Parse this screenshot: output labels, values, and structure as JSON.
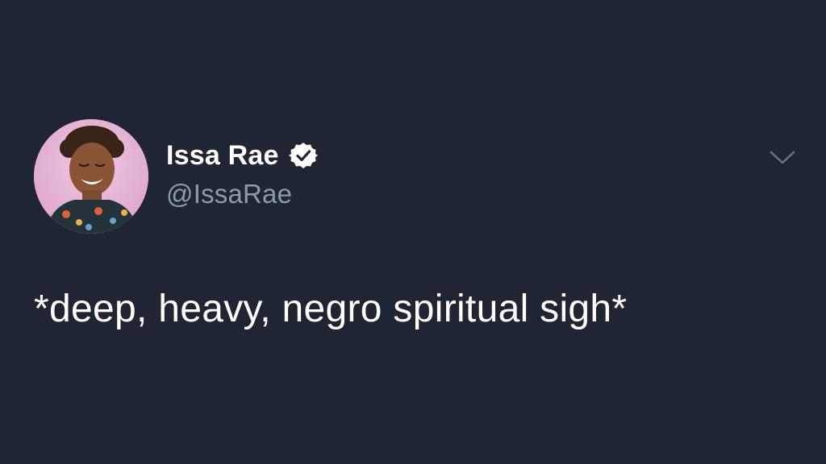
{
  "tweet": {
    "author": {
      "display_name": "Issa Rae",
      "handle": "@IssaRae",
      "verified": true,
      "avatar_icon": "profile-photo"
    },
    "text": "*deep, heavy, negro spiritual sigh*",
    "menu_icon": "chevron-down-icon"
  },
  "colors": {
    "background": "#1f2532",
    "name_text": "#ffffff",
    "handle_text": "#8e9aaa",
    "body_text": "#ffffff",
    "chevron": "#6b7584"
  }
}
